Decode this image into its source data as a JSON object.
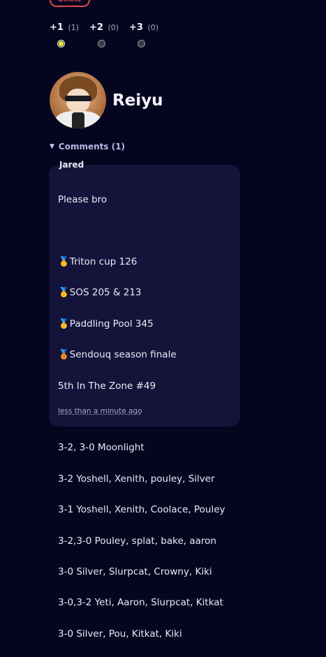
{
  "delete_button": {
    "label": "Delete"
  },
  "votes": [
    {
      "label": "+1",
      "count": "(1)",
      "selected": true
    },
    {
      "label": "+2",
      "count": "(0)",
      "selected": false
    },
    {
      "label": "+3",
      "count": "(0)",
      "selected": false
    }
  ],
  "profile": {
    "username": "Reiyu"
  },
  "comments": {
    "toggle_label": "Comments (1)",
    "items": [
      {
        "author": "Jared",
        "lines": [
          "Please bro",
          "",
          "🥇Triton cup 126",
          "🥇SOS 205 & 213",
          "🥇Paddling Pool 345",
          "🥉Sendouq season finale",
          "5th In The Zone #49",
          "",
          "3-2, 3-0 Moonlight",
          "3-2 Yoshell, Xenith, pouley, Silver",
          "3-1 Yoshell, Xenith, Coolace, Pouley",
          "3-2,3-0 Pouley, splat, bake, aaron",
          "3-0 Silver, Slurpcat, Crowny, Kiki",
          "3-0,3-2 Yeti, Aaron, Slurpcat, Kitkat",
          "3-0 Silver, Pou, Kitkat, Kiki"
        ],
        "timestamp": "less than a minute ago"
      }
    ]
  },
  "colors": {
    "background": "#05051f",
    "card": "#14133a",
    "danger": "#e0454f",
    "selected_radio": "#ecec3c"
  }
}
